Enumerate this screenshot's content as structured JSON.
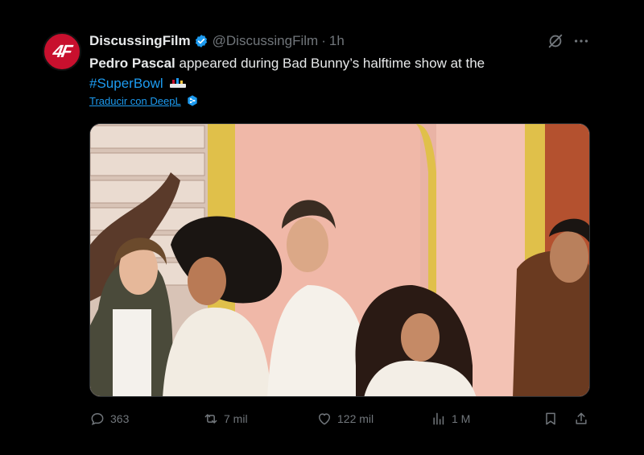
{
  "tweet": {
    "avatar_text": "4F",
    "author_name": "DiscussingFilm",
    "author_handle": "@DiscussingFilm",
    "separator": "·",
    "time": "1h",
    "text_bold": "Pedro Pascal",
    "text_rest": " appeared during Bad Bunny’s halftime show at the",
    "hashtag": "#SuperBowl",
    "translate_label": "Traducir con DeepL"
  },
  "metrics": {
    "replies": "363",
    "reposts": "7 mil",
    "likes": "122 mil",
    "views": "1 M"
  },
  "icons": {
    "verified": "verified-badge-icon",
    "grok": "grok-icon",
    "more": "more-icon",
    "deepl": "deepl-icon",
    "reply": "reply-icon",
    "repost": "repost-icon",
    "like": "like-icon",
    "views": "views-icon",
    "bookmark": "bookmark-icon",
    "share": "share-icon"
  },
  "colors": {
    "background": "#000000",
    "text": "#e7e9ea",
    "muted": "#71767b",
    "accent": "#1d9bf0",
    "avatar": "#c8102e"
  }
}
